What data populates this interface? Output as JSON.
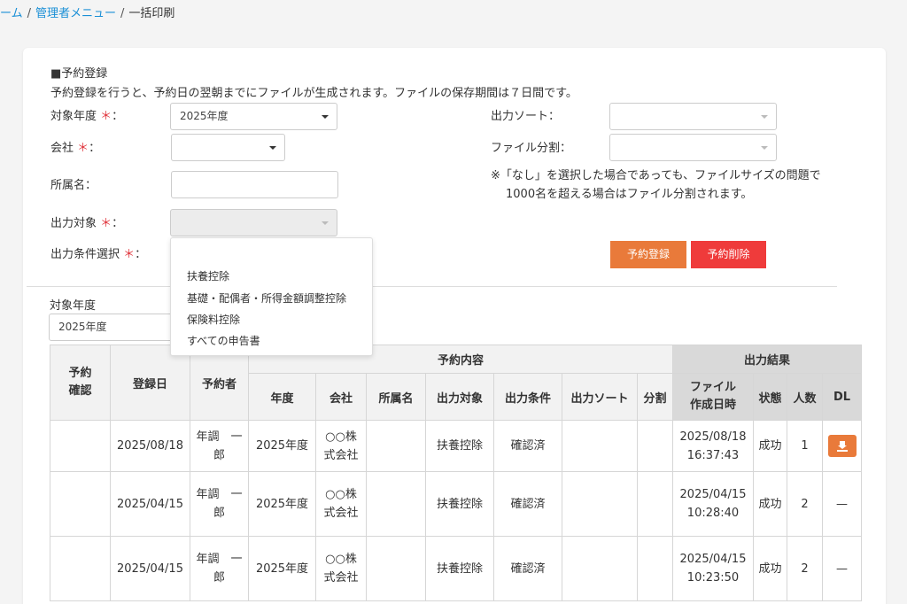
{
  "breadcrumb": {
    "home": "ーム",
    "admin": "管理者メニュー",
    "current": "一括印刷",
    "sep": "/"
  },
  "section": {
    "title": "■予約登録",
    "description": "予約登録を行うと、予約日の翌朝までにファイルが生成されます。ファイルの保存期間は７日間です。"
  },
  "form": {
    "year_label": "対象年度",
    "year_value": "2025年度",
    "company_label": "会社",
    "dept_label": "所属名",
    "target_label": "出力対象",
    "condition_label": "出力条件選択",
    "required_mark": "＊",
    "colon": "：",
    "sort_label": "出力ソート",
    "split_label": "ファイル分割",
    "note_line1": "※「なし」を選択した場合であっても、ファイルサイズの問題で",
    "note_line2": "1000名を超える場合はファイル分割されます。"
  },
  "buttons": {
    "reserve": "予約登録",
    "delete": "予約削除"
  },
  "dropdown_options": [
    "扶養控除",
    "基礎・配偶者・所得金額調整控除",
    "保険料控除",
    "すべての申告書"
  ],
  "filter": {
    "label": "対象年度",
    "value": "2025年度"
  },
  "table": {
    "headers": {
      "confirm": "予約\n確認",
      "reg_date": "登録日",
      "reserver": "予約者",
      "content_group": "予約内容",
      "result_group": "出力結果",
      "year": "年度",
      "company": "会社",
      "dept": "所属名",
      "target": "出力対象",
      "condition": "出力条件",
      "sort": "出力ソート",
      "split": "分割",
      "file_date": "ファイル\n作成日時",
      "status": "状態",
      "count": "人数",
      "dl": "DL"
    },
    "rows": [
      {
        "reg_date": "2025/08/18",
        "reserver": "年調　一\n郎",
        "year": "2025年度",
        "company": "○○株\n式会社",
        "dept": "",
        "target": "扶養控除",
        "condition": "確認済",
        "sort": "",
        "split": "",
        "file_date": "2025/08/18\n16:37:43",
        "status": "成功",
        "count": "1",
        "dl": "download"
      },
      {
        "reg_date": "2025/04/15",
        "reserver": "年調　一\n郎",
        "year": "2025年度",
        "company": "○○株\n式会社",
        "dept": "",
        "target": "扶養控除",
        "condition": "確認済",
        "sort": "",
        "split": "",
        "file_date": "2025/04/15\n10:28:40",
        "status": "成功",
        "count": "2",
        "dl": "—"
      },
      {
        "reg_date": "2025/04/15",
        "reserver": "年調　一\n郎",
        "year": "2025年度",
        "company": "○○株\n式会社",
        "dept": "",
        "target": "扶養控除",
        "condition": "確認済",
        "sort": "",
        "split": "",
        "file_date": "2025/04/15\n10:23:50",
        "status": "成功",
        "count": "2",
        "dl": "—"
      }
    ]
  },
  "icons": {
    "download": "download-icon",
    "dropdown": "chevron-down-icon"
  },
  "colors": {
    "link": "#1a8fd6",
    "accent_orange": "#e97a3a",
    "danger_red": "#ef3b3b",
    "required": "#e0323a"
  }
}
